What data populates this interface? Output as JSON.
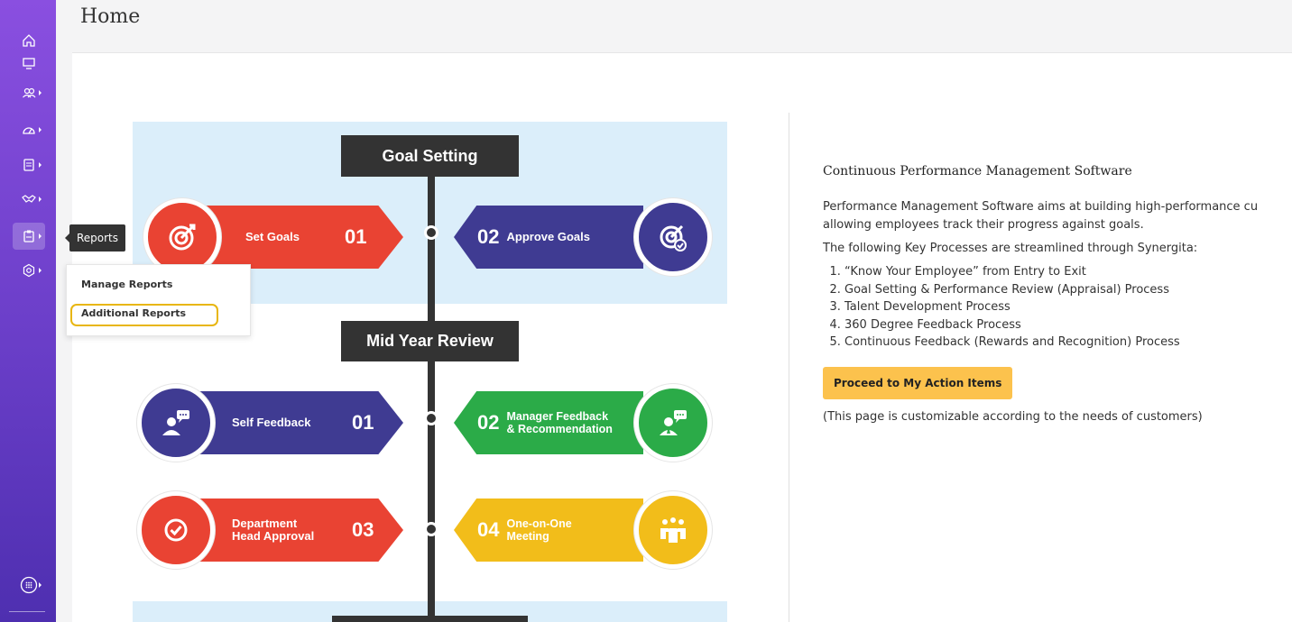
{
  "page": {
    "title": "Home"
  },
  "sidebar": {
    "items": [
      {
        "icon": "home-icon"
      },
      {
        "icon": "monitor-icon"
      },
      {
        "icon": "users-icon"
      },
      {
        "icon": "dashboard-icon"
      },
      {
        "icon": "document-icon"
      },
      {
        "icon": "handshake-icon"
      },
      {
        "icon": "clipboard-icon"
      },
      {
        "icon": "settings-icon"
      },
      {
        "icon": "apps-icon"
      }
    ]
  },
  "tooltip": {
    "label": "Reports"
  },
  "reports_menu": {
    "items": [
      "Manage Reports",
      "Additional Reports"
    ],
    "highlighted": "Additional Reports"
  },
  "infographic": {
    "sections": [
      "Goal Setting",
      "Mid Year Review"
    ],
    "steps": [
      {
        "label": "Set Goals",
        "number": "01",
        "color": "#e94333",
        "icon": "target-icon"
      },
      {
        "label": "Approve Goals",
        "number": "02",
        "color": "#3f3b92",
        "icon": "target-check-icon"
      },
      {
        "label": "Self Feedback",
        "number": "01",
        "color": "#3f3b92",
        "icon": "feedback-person-icon"
      },
      {
        "label_line1": "Manager Feedback",
        "label_line2": "& Recommendation",
        "number": "02",
        "color": "#2bab48",
        "icon": "manager-feedback-icon"
      },
      {
        "label_line1": "Department",
        "label_line2": "Head Approval",
        "number": "03",
        "color": "#e94333",
        "icon": "check-circle-icon"
      },
      {
        "label_line1": "One-on-One",
        "label_line2": "Meeting",
        "number": "04",
        "color": "#f2bd1a",
        "icon": "meeting-icon"
      }
    ]
  },
  "main": {
    "heading": "Continuous Performance Management Software",
    "intro_line1": "Performance Management Software aims at building high-performance cu",
    "intro_line2": "allowing employees track their progress against goals.",
    "processes_intro": "The following Key Processes are streamlined through Synergita:",
    "processes": [
      "“Know Your Employee” from Entry to Exit",
      "Goal Setting & Performance Review (Appraisal) Process",
      "Talent Development Process",
      "360 Degree Feedback Process",
      "Continuous Feedback (Rewards and Recognition) Process"
    ],
    "proceed_button": "Proceed to My Action Items",
    "note": "(This page is customizable according to the needs of customers)"
  },
  "colors": {
    "sidebar_top": "#8a4fe0",
    "sidebar_bottom": "#4e2fb0",
    "button": "#fcc24d",
    "highlight": "#e8b611"
  }
}
